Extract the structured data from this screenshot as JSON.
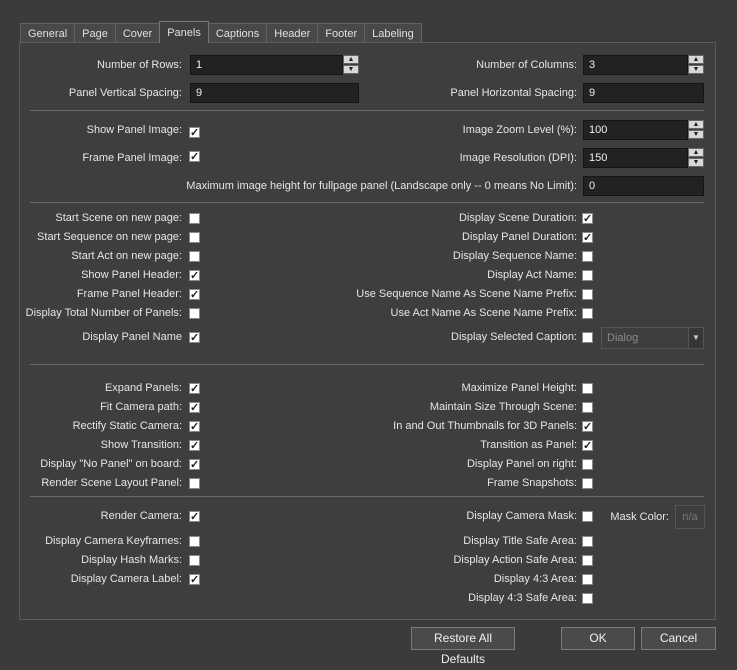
{
  "tabs": [
    {
      "label": "General"
    },
    {
      "label": "Page"
    },
    {
      "label": "Cover"
    },
    {
      "label": "Panels"
    },
    {
      "label": "Captions"
    },
    {
      "label": "Header"
    },
    {
      "label": "Footer"
    },
    {
      "label": "Labeling"
    }
  ],
  "layout": {
    "rows_label": "Number of Rows:",
    "rows_value": "1",
    "cols_label": "Number of Columns:",
    "cols_value": "3",
    "vspacing_label": "Panel Vertical Spacing:",
    "vspacing_value": "9",
    "hspacing_label": "Panel Horizontal Spacing:",
    "hspacing_value": "9"
  },
  "image": {
    "show_label": "Show Panel Image:",
    "frame_label": "Frame Panel Image:",
    "zoom_label": "Image Zoom Level (%):",
    "zoom_value": "100",
    "res_label": "Image Resolution (DPI):",
    "res_value": "150",
    "maxh_label": "Maximum image height for fullpage panel (Landscape only -- 0 means No Limit):",
    "maxh_value": "0"
  },
  "options_left": [
    {
      "label": "Start Scene on new page:",
      "checked": false
    },
    {
      "label": "Start Sequence on new page:",
      "checked": false
    },
    {
      "label": "Start Act on new page:",
      "checked": false
    },
    {
      "label": "Show Panel Header:",
      "checked": true
    },
    {
      "label": "Frame Panel Header:",
      "checked": true
    },
    {
      "label": "Display Total Number of Panels:",
      "checked": false
    },
    {
      "label": "Display Panel Name",
      "checked": true
    }
  ],
  "options_right": [
    {
      "label": "Display Scene Duration:",
      "checked": true
    },
    {
      "label": "Display Panel Duration:",
      "checked": true
    },
    {
      "label": "Display Sequence Name:",
      "checked": false
    },
    {
      "label": "Display Act Name:",
      "checked": false
    },
    {
      "label": "Use Sequence Name As Scene Name Prefix:",
      "checked": false
    },
    {
      "label": "Use Act Name As Scene Name Prefix:",
      "checked": false
    },
    {
      "label": "Display Selected Caption:",
      "checked": false
    }
  ],
  "caption_dropdown": "Dialog",
  "options2_left": [
    {
      "label": "Expand Panels:",
      "checked": true
    },
    {
      "label": "Fit Camera path:",
      "checked": true
    },
    {
      "label": "Rectify Static Camera:",
      "checked": true
    },
    {
      "label": "Show Transition:",
      "checked": true
    },
    {
      "label": "Display \"No Panel\" on board:",
      "checked": true
    },
    {
      "label": "Render Scene Layout Panel:",
      "checked": false
    }
  ],
  "options2_right": [
    {
      "label": "Maximize Panel Height:",
      "checked": false
    },
    {
      "label": "Maintain Size Through Scene:",
      "checked": false
    },
    {
      "label": "In and Out Thumbnails for 3D Panels:",
      "checked": true
    },
    {
      "label": "Transition as Panel:",
      "checked": true
    },
    {
      "label": "Display Panel on right:",
      "checked": false
    },
    {
      "label": "Frame Snapshots:",
      "checked": false
    }
  ],
  "camera_left": [
    {
      "label": "Render Camera:",
      "checked": true
    },
    {
      "label": "Display Camera Keyframes:",
      "checked": false
    },
    {
      "label": "Display Hash Marks:",
      "checked": false
    },
    {
      "label": "Display Camera Label:",
      "checked": true
    }
  ],
  "camera_right": [
    {
      "label": "Display Camera Mask:",
      "checked": false
    },
    {
      "label": "Display Title Safe Area:",
      "checked": false
    },
    {
      "label": "Display Action Safe Area:",
      "checked": false
    },
    {
      "label": "Display 4:3 Area:",
      "checked": false
    },
    {
      "label": "Display 4:3 Safe Area:",
      "checked": false
    }
  ],
  "mask_color_label": "Mask Color:",
  "mask_color_value": "n/a",
  "buttons": {
    "restore": "Restore All Defaults",
    "ok": "OK",
    "cancel": "Cancel"
  }
}
